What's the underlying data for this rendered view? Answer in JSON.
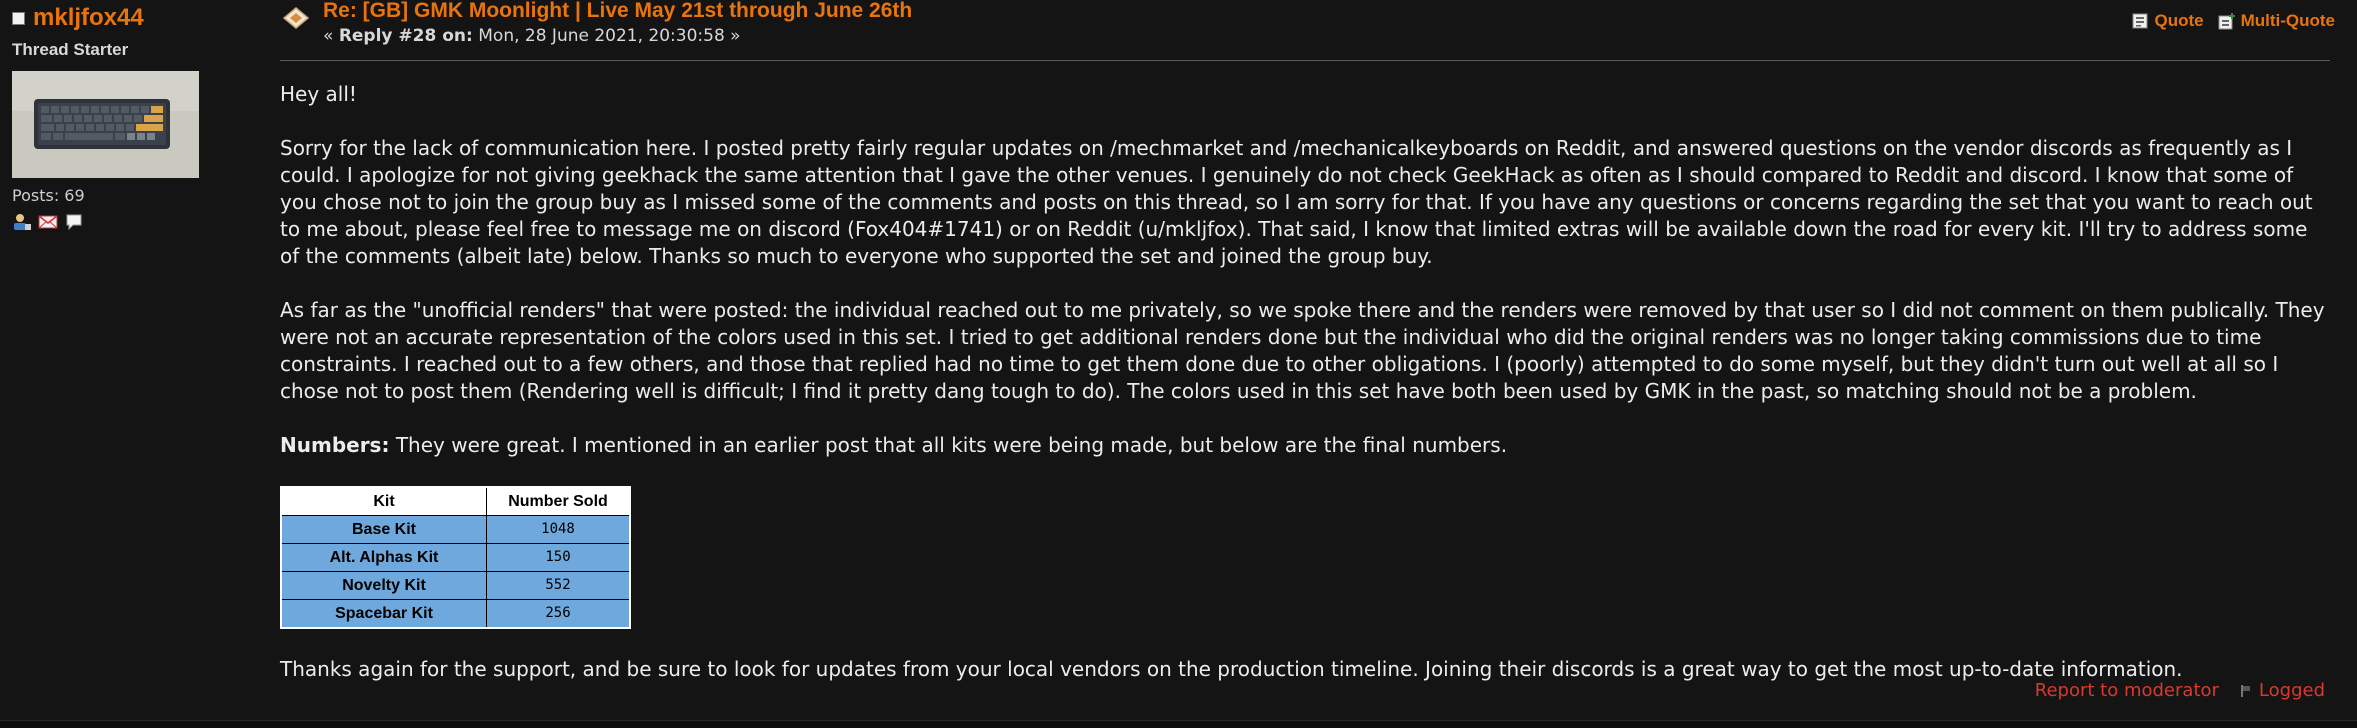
{
  "poster": {
    "username": "mkljfox44",
    "group": "Thread Starter",
    "posts": "Posts: 69",
    "avatar_icon": "keyboard-image",
    "profile_icons": [
      "profile-icon",
      "email-icon",
      "message-icon"
    ]
  },
  "header": {
    "subject": "Re: [GB] GMK Moonlight | Live May 21st through June 26th",
    "meta_prefix": "« ",
    "reply_label": "Reply #28 on:",
    "date": " Mon, 28 June 2021, 20:30:58 »",
    "quote_label": "Quote",
    "multi_quote_label": "Multi-Quote"
  },
  "body": {
    "greeting": "Hey all!",
    "para1": "Sorry for the lack of communication here. I posted pretty fairly regular updates on /mechmarket and /mechanicalkeyboards on Reddit, and answered questions on the vendor discords as frequently as I could. I apologize for not giving geekhack the same attention that I gave the other venues. I genuinely do not check GeekHack as often as I should compared to Reddit and discord. I know that some of you chose not to join the group buy as I missed some of the comments and posts on this thread, so I am sorry for that. If you have any questions or concerns regarding the set that you want to reach out to me about, please feel free to message me on discord (Fox404#1741) or on Reddit (u/mkljfox). That said, I know that limited extras will be available down the road for every kit. I'll try to address some of the comments (albeit late) below. Thanks so much to everyone who supported the set and joined the group buy.",
    "para2": "As far as the \"unofficial renders\" that were posted: the individual reached out to me privately, so we spoke there and the renders were removed by that user so I did not comment on them publically. They were not an accurate representation of the colors used in this set. I tried to get additional renders done but the individual who did the original renders was no longer taking commissions due to time constraints. I reached out to a few others, and those that replied had no time to get them done due to other obligations. I (poorly) attempted to do some myself, but they didn't turn out well at all so I chose not to post them (Rendering well is difficult; I find it pretty dang tough to do). The colors used in this set have both been used by GMK in the past, so matching should not be a problem.",
    "numbers_label": "Numbers:",
    "numbers_text": " They were great. I mentioned in an earlier post that all kits were being made, but below are the final numbers.",
    "closing": "Thanks again for the support, and be sure to look for updates from your local vendors on the production timeline. Joining their discords is a great way to get the most up-to-date information."
  },
  "table": {
    "headers": [
      "Kit",
      "Number Sold"
    ],
    "rows": [
      {
        "kit": "Base Kit",
        "sold": "1048"
      },
      {
        "kit": "Alt. Alphas Kit",
        "sold": "150"
      },
      {
        "kit": "Novelty Kit",
        "sold": "552"
      },
      {
        "kit": "Spacebar Kit",
        "sold": "256"
      }
    ],
    "header_bg": "#ffffff",
    "cell_bg": "#6fa8dc"
  },
  "footer": {
    "report_label": "Report to moderator",
    "logged_label": "Logged"
  },
  "colors": {
    "accent": "#e8740c",
    "background": "#141414",
    "link_red": "#d9392e"
  }
}
